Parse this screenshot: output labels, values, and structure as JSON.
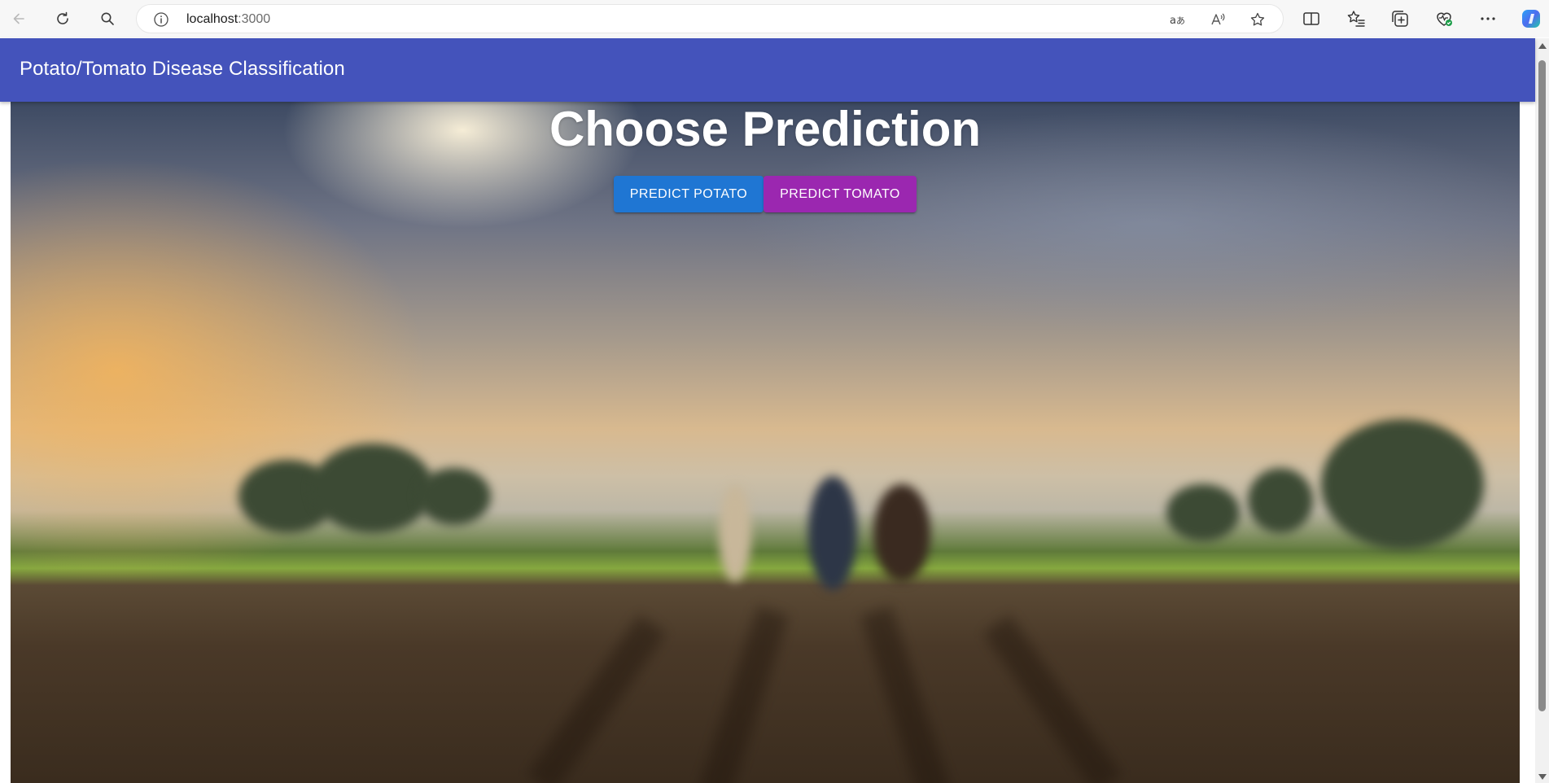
{
  "browser": {
    "address_host": "localhost",
    "address_port": ":3000"
  },
  "app_bar": {
    "title": "Potato/Tomato Disease Classification",
    "color": "#4453bb"
  },
  "main": {
    "heading": "Choose Prediction",
    "buttons": [
      {
        "label": "PREDICT POTATO",
        "color": "#1f76d3"
      },
      {
        "label": "PREDICT TOMATO",
        "color": "#9b27b0"
      }
    ]
  },
  "icons": {
    "back": "back-arrow-icon",
    "reload": "reload-icon",
    "search": "search-icon",
    "info": "site-info-icon",
    "translate": "translate-icon",
    "read_aloud": "read-aloud-icon",
    "favorite": "favorite-star-icon",
    "split": "split-screen-icon",
    "favorites": "favorites-list-icon",
    "collections": "collections-icon",
    "health": "browser-essentials-icon",
    "more": "more-options-icon",
    "copilot": "copilot-icon"
  }
}
